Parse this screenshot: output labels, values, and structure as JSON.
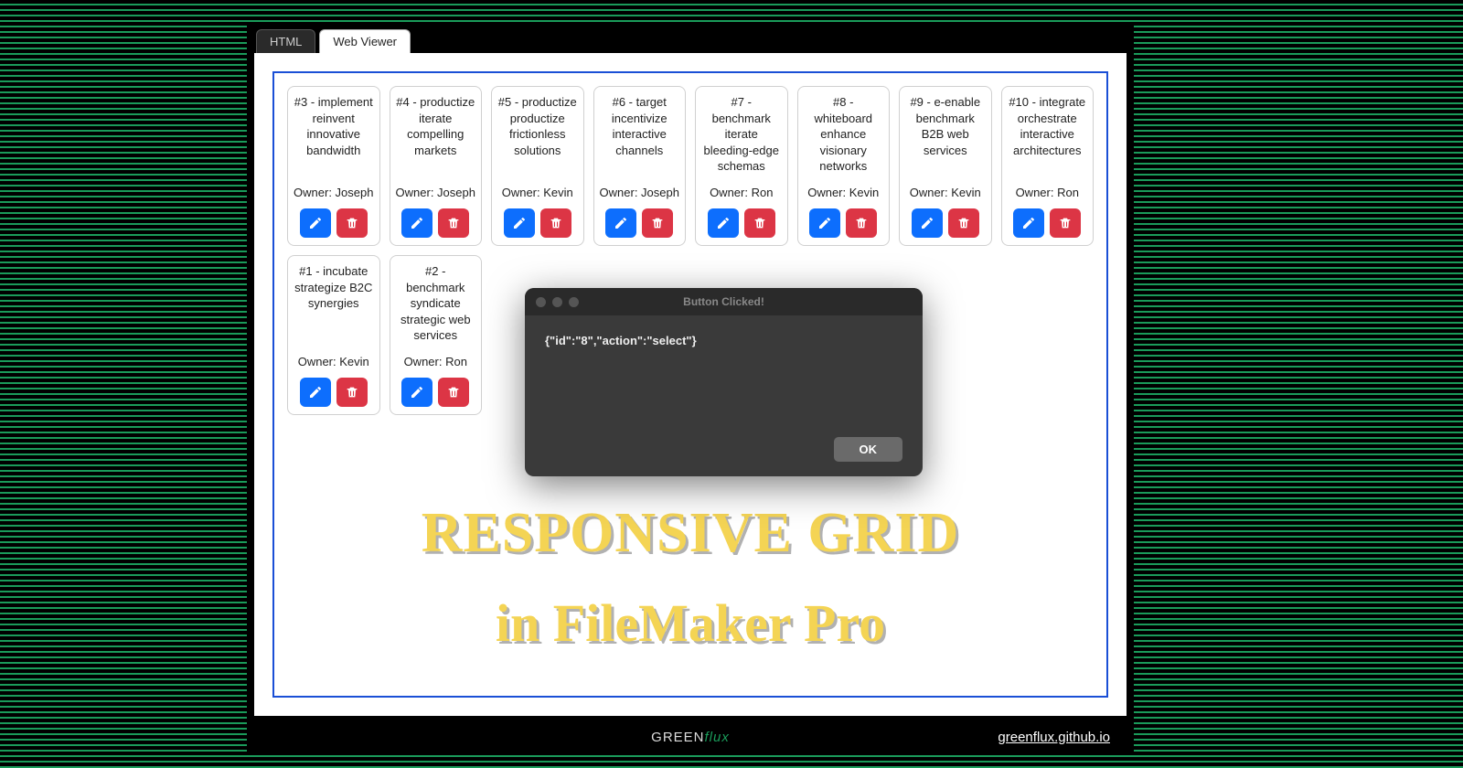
{
  "tabs": {
    "html": "HTML",
    "webviewer": "Web Viewer"
  },
  "cards_row1": [
    {
      "num": "#3",
      "task": "implement reinvent innovative bandwidth",
      "owner": "Owner: Joseph"
    },
    {
      "num": "#4",
      "task": "productize iterate compelling markets",
      "owner": "Owner: Joseph"
    },
    {
      "num": "#5",
      "task": "productize productize frictionless solutions",
      "owner": "Owner: Kevin"
    },
    {
      "num": "#6",
      "task": "target incentivize interactive channels",
      "owner": "Owner: Joseph"
    },
    {
      "num": "#7",
      "task": "benchmark iterate bleeding-edge schemas",
      "owner": "Owner: Ron"
    },
    {
      "num": "#8",
      "task": "whiteboard enhance visionary networks",
      "owner": "Owner: Kevin"
    },
    {
      "num": "#9",
      "task": "e-enable benchmark B2B web services",
      "owner": "Owner: Kevin"
    },
    {
      "num": "#10",
      "task": "integrate orchestrate interactive architectures",
      "owner": "Owner: Ron"
    }
  ],
  "cards_row2": [
    {
      "num": "#1",
      "task": "incubate strategize B2C synergies",
      "owner": "Owner: Kevin"
    },
    {
      "num": "#2",
      "task": "benchmark syndicate strategic web services",
      "owner": "Owner: Ron"
    }
  ],
  "dialog": {
    "title": "Button Clicked!",
    "body": "{\"id\":\"8\",\"action\":\"select\"}",
    "ok": "OK"
  },
  "headline": {
    "line1": "RESPONSIVE GRID",
    "line2": "in FileMaker Pro"
  },
  "footer": {
    "brand_a": "GREEN",
    "brand_b": "flux",
    "link": "greenflux.github.io"
  }
}
